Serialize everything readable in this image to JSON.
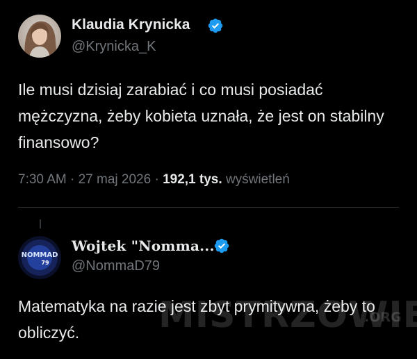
{
  "tweet": {
    "author": {
      "name": "Klaudia Krynicka",
      "handle": "@Krynicka_K",
      "verified": true
    },
    "text": "Ile musi dzisiaj zarabiać i co musi posiadać mężczyzna, żeby kobieta uznała, że jest on stabilny finansowo?",
    "time": "7:30 AM",
    "separator": "·",
    "date": "27 maj 2026",
    "views_count": "192,1 tys.",
    "views_label": "wyświetleń"
  },
  "reply": {
    "author": {
      "name": "Wojtek \"Nomma...",
      "handle": "@NommaD79",
      "verified": true,
      "avatar_text": "NOMMAD",
      "avatar_number": "79"
    },
    "text": "Matematyka na razie jest zbyt prymitywna, żeby to obliczyć."
  },
  "watermark": {
    "text": "MISTRZOWIE",
    "suffix": ".ORG"
  },
  "colors": {
    "background": "#000000",
    "text_primary": "#e7e9ea",
    "text_secondary": "#71767b",
    "verified": "#1d9bf0",
    "divider": "#2f3336"
  }
}
